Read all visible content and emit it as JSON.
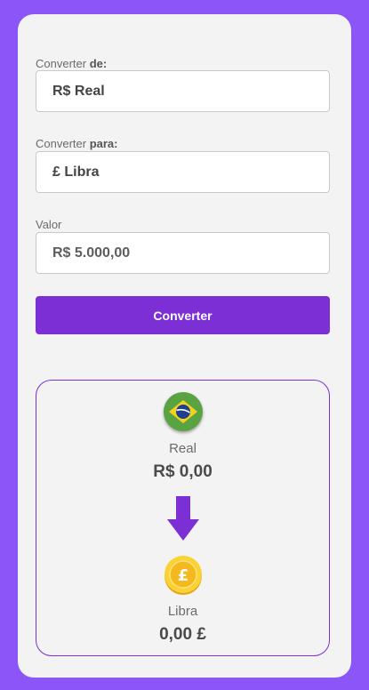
{
  "form": {
    "from": {
      "label_prefix": "Converter ",
      "label_bold": "de:",
      "value": "R$ Real"
    },
    "to": {
      "label_prefix": "Converter ",
      "label_bold": "para:",
      "value": "£ Libra"
    },
    "amount": {
      "label": "Valor",
      "value": "R$ 5.000,00"
    },
    "convert_button": "Converter"
  },
  "result": {
    "source": {
      "icon": "brazil-flag-icon",
      "name": "Real",
      "value": "R$ 0,00"
    },
    "arrow_icon": "arrow-down-icon",
    "target": {
      "icon": "pound-coin-icon",
      "name": "Libra",
      "value": "0,00 £"
    }
  },
  "colors": {
    "background": "#8b55f7",
    "card": "#f3f3f3",
    "accent": "#7b2fd4"
  }
}
